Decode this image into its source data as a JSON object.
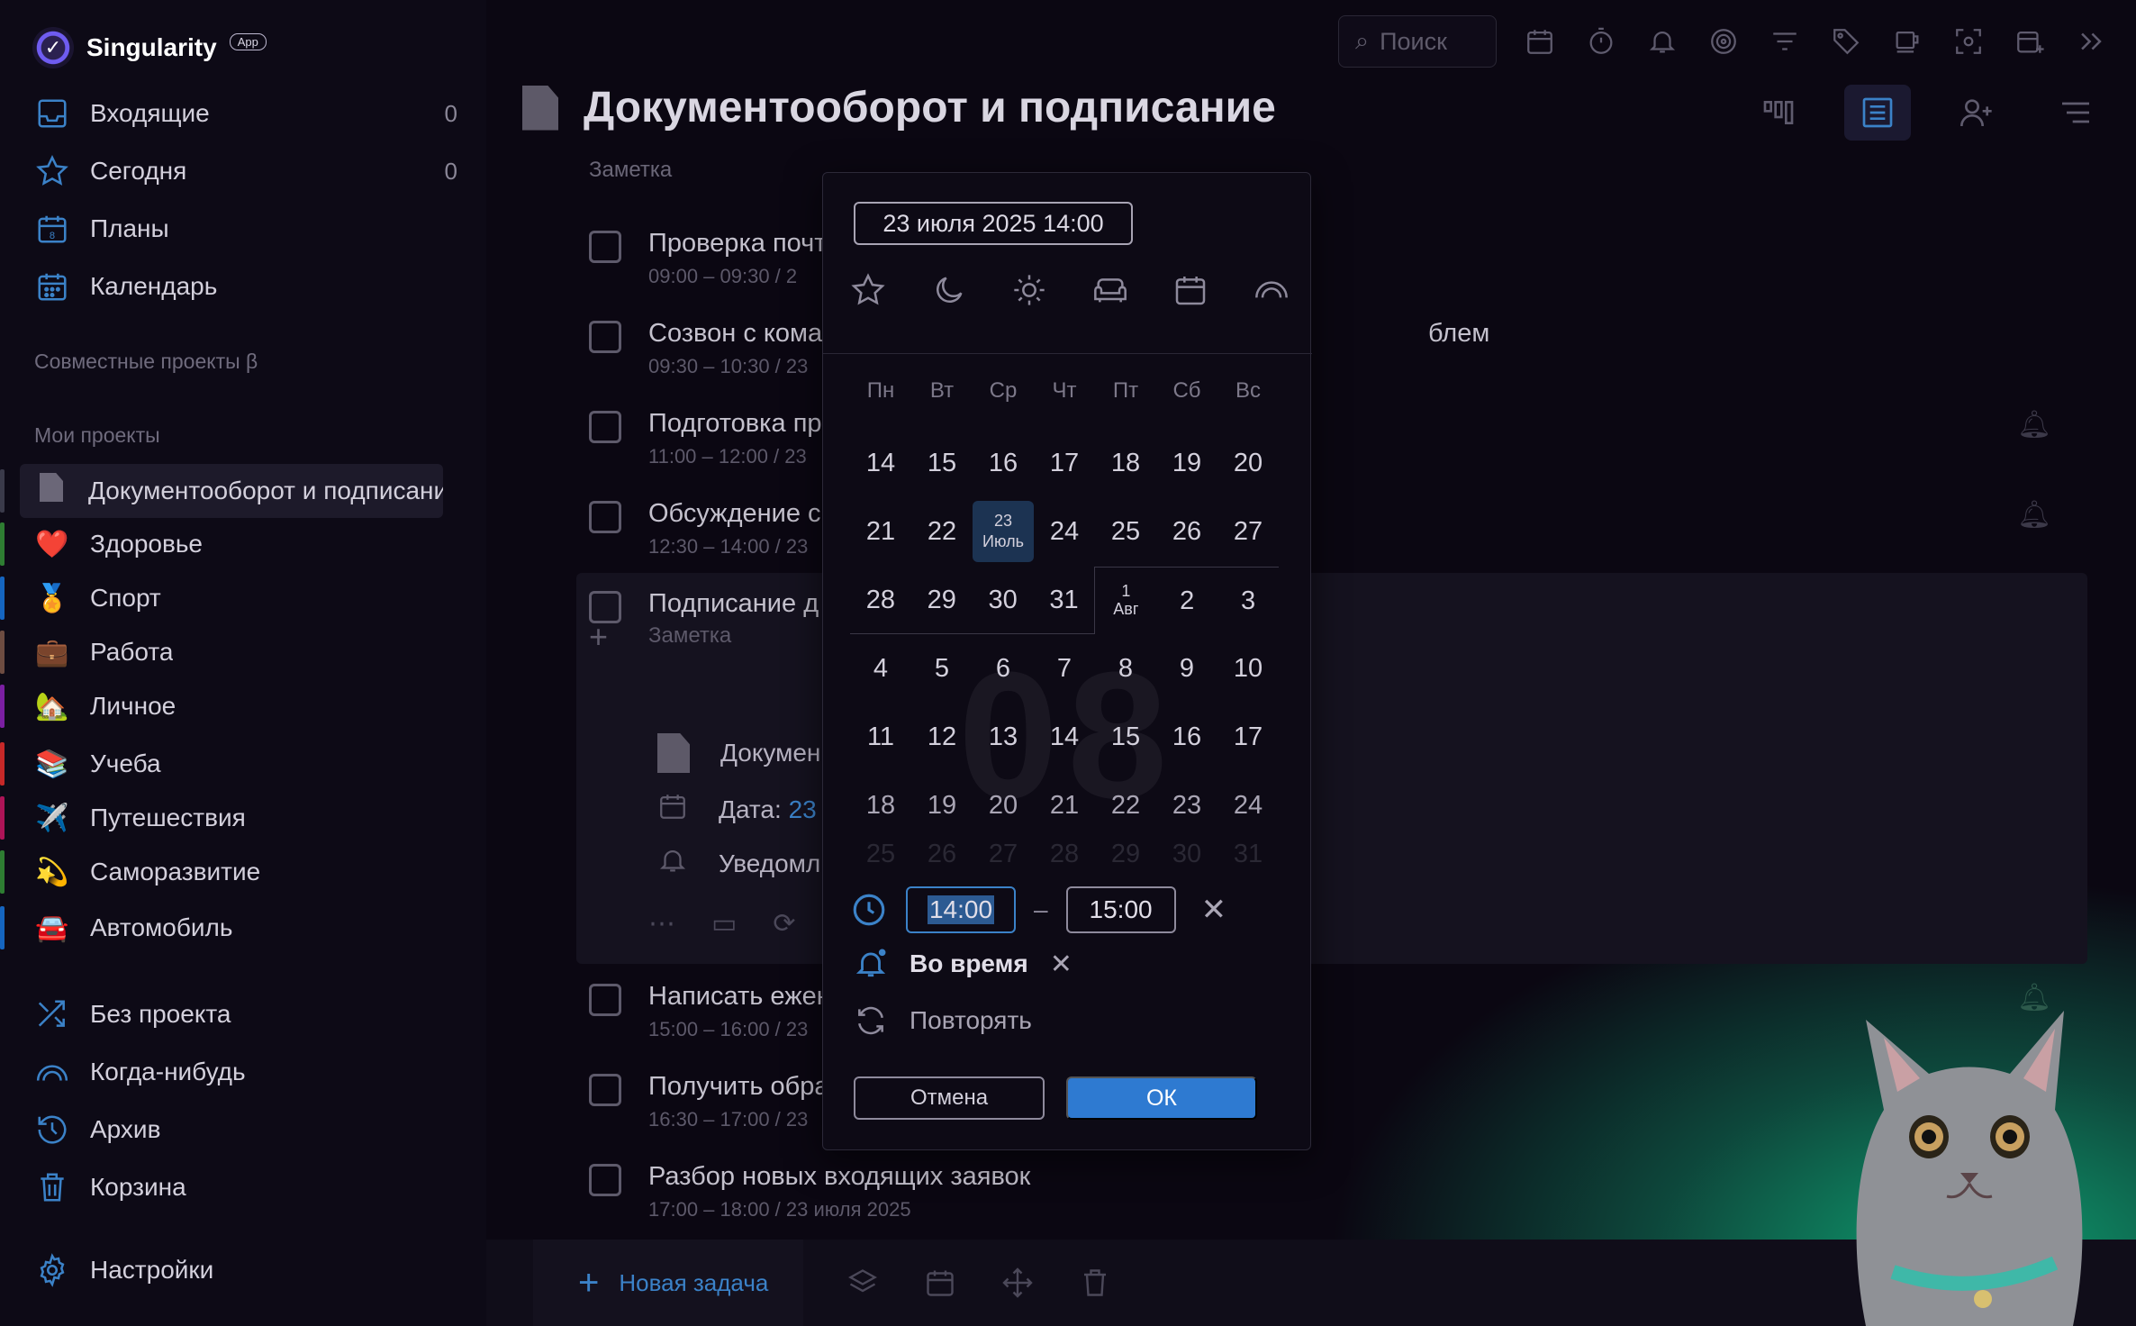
{
  "app": {
    "name": "Singularity",
    "badge": "App"
  },
  "sidebar": {
    "nav": [
      {
        "label": "Входящие",
        "count": "0",
        "icon": "inbox-icon"
      },
      {
        "label": "Сегодня",
        "count": "0",
        "icon": "star-icon"
      },
      {
        "label": "Планы",
        "count": "",
        "icon": "calendar-day-icon"
      },
      {
        "label": "Календарь",
        "count": "",
        "icon": "calendar-grid-icon"
      }
    ],
    "shared_title": "Совместные проекты β",
    "projects_title": "Мои проекты",
    "projects": [
      {
        "label": "Документооборот и подписание",
        "emoji": "",
        "color": "#3b3a4a",
        "active": true
      },
      {
        "label": "Здоровье",
        "emoji": "❤️",
        "color": "#2e7d32"
      },
      {
        "label": "Спорт",
        "emoji": "🏅",
        "color": "#1565c0"
      },
      {
        "label": "Работа",
        "emoji": "💼",
        "color": "#6d4c41"
      },
      {
        "label": "Личное",
        "emoji": "🏡",
        "color": "#7b1fa2"
      },
      {
        "label": "Учеба",
        "emoji": "📚",
        "color": "#c62828"
      },
      {
        "label": "Путешествия",
        "emoji": "✈️",
        "color": "#ad1457"
      },
      {
        "label": "Саморазвитие",
        "emoji": "💫",
        "color": "#2e7d32"
      },
      {
        "label": "Автомобиль",
        "emoji": "🚘",
        "color": "#1565c0"
      }
    ],
    "bottom_nav": [
      {
        "label": "Без проекта",
        "icon": "shuffle-icon"
      },
      {
        "label": "Когда-нибудь",
        "icon": "rainbow-icon"
      },
      {
        "label": "Архив",
        "icon": "history-icon"
      },
      {
        "label": "Корзина",
        "icon": "trash-icon"
      }
    ],
    "settings_label": "Настройки"
  },
  "topbar": {
    "search_placeholder": "Поиск"
  },
  "page": {
    "title": "Документооборот и подписание",
    "subtitle": "Заметка"
  },
  "tasks": [
    {
      "title": "Проверка почт",
      "date": "09:00 – 09:30 / 2",
      "bell": false
    },
    {
      "title": "Созвон с кома",
      "title_tail": "блем",
      "date": "09:30 – 10:30 / 23",
      "bell": false
    },
    {
      "title": "Подготовка пр",
      "date": "11:00 – 12:00 / 23",
      "bell": true
    },
    {
      "title": "Обсуждение с",
      "date": "12:30 – 14:00 / 23",
      "bell": true
    },
    {
      "title": "Подписание д",
      "date": "",
      "bell": false
    },
    {
      "title": "Написать ежен",
      "date": "15:00 – 16:00 / 23",
      "bell": true
    },
    {
      "title": "Получить обра",
      "date": "16:30 – 17:00 / 23",
      "bell": false
    },
    {
      "title": "Разбор новых входящих заявок",
      "date": "17:00 – 18:00 / 23 июля 2025",
      "bell": false
    }
  ],
  "expanded": {
    "note_placeholder": "Заметка",
    "doc_label": "Докумен",
    "date_label": "Дата:",
    "date_value": "23",
    "reminder_label": "Уведомл"
  },
  "bottombar": {
    "new_task": "Новая задача"
  },
  "picker": {
    "datetime": "23 июля 2025 14:00",
    "weekdays": [
      "Пн",
      "Вт",
      "Ср",
      "Чт",
      "Пт",
      "Сб",
      "Вс"
    ],
    "weeks": [
      [
        "14",
        "15",
        "16",
        "17",
        "18",
        "19",
        "20"
      ],
      [
        "21",
        "22",
        "23",
        "24",
        "25",
        "26",
        "27"
      ],
      [
        "28",
        "29",
        "30",
        "31",
        "1",
        "2",
        "3"
      ],
      [
        "4",
        "5",
        "6",
        "7",
        "8",
        "9",
        "10"
      ],
      [
        "11",
        "12",
        "13",
        "14",
        "15",
        "16",
        "17"
      ],
      [
        "18",
        "19",
        "20",
        "21",
        "22",
        "23",
        "24"
      ],
      [
        "25",
        "26",
        "27",
        "28",
        "29",
        "30",
        "31"
      ]
    ],
    "selected_day": "23",
    "selected_month": "Июль",
    "next_month_start": "1",
    "next_month_label": "Авг",
    "watermark": "08",
    "time_start": "14:00",
    "time_end": "15:00",
    "reminder": "Во время",
    "repeat": "Повторять",
    "cancel": "Отмена",
    "ok": "ОК"
  },
  "colors": {
    "accent": "#3b82c8",
    "selected": "#1c3352",
    "ok": "#2e7ad1"
  }
}
